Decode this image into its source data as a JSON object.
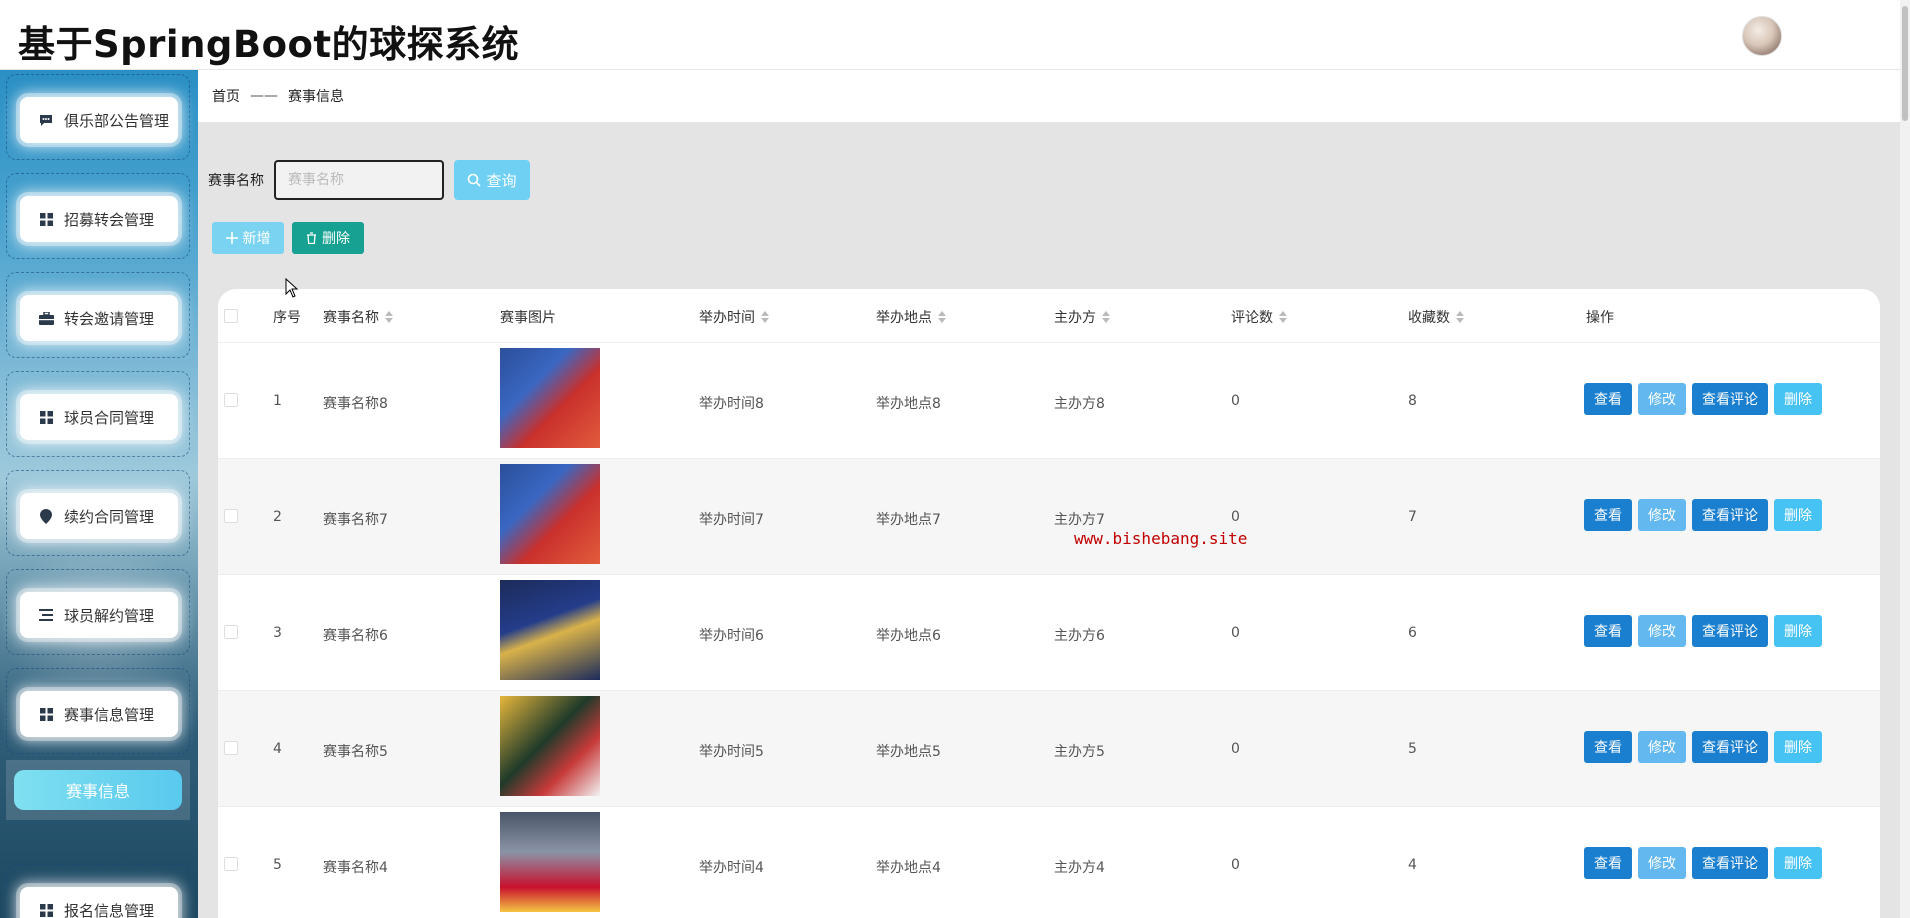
{
  "header": {
    "title": "基于SpringBoot的球探系统"
  },
  "sidebar": {
    "items": [
      {
        "label": "俱乐部公告管理",
        "icon": "chat-icon"
      },
      {
        "label": "招募转会管理",
        "icon": "grid-icon"
      },
      {
        "label": "转会邀请管理",
        "icon": "briefcase-icon"
      },
      {
        "label": "球员合同管理",
        "icon": "grid-icon"
      },
      {
        "label": "续约合同管理",
        "icon": "location-pin-icon"
      },
      {
        "label": "球员解约管理",
        "icon": "list-icon"
      },
      {
        "label": "赛事信息管理",
        "icon": "grid-icon"
      },
      {
        "label": "报名信息管理",
        "icon": "grid-icon"
      }
    ],
    "active_sub": "赛事信息"
  },
  "breadcrumb": {
    "home": "首页",
    "sep": "——",
    "current": "赛事信息"
  },
  "search": {
    "label": "赛事名称",
    "placeholder": "赛事名称",
    "value": "",
    "query_label": "查询"
  },
  "actions": {
    "add_label": "新增",
    "delete_label": "删除"
  },
  "table": {
    "headers": {
      "index": "序号",
      "name": "赛事名称",
      "image": "赛事图片",
      "time": "举办时间",
      "place": "举办地点",
      "organizer": "主办方",
      "comments": "评论数",
      "favorites": "收藏数",
      "ops": "操作"
    },
    "op_labels": {
      "view": "查看",
      "edit": "修改",
      "comments": "查看评论",
      "delete": "删除"
    },
    "rows": [
      {
        "index": "1",
        "name": "赛事名称8",
        "time": "举办时间8",
        "place": "举办地点8",
        "organizer": "主办方8",
        "comments": "0",
        "favorites": "8"
      },
      {
        "index": "2",
        "name": "赛事名称7",
        "time": "举办时间7",
        "place": "举办地点7",
        "organizer": "主办方7",
        "comments": "0",
        "favorites": "7"
      },
      {
        "index": "3",
        "name": "赛事名称6",
        "time": "举办时间6",
        "place": "举办地点6",
        "organizer": "主办方6",
        "comments": "0",
        "favorites": "6"
      },
      {
        "index": "4",
        "name": "赛事名称5",
        "time": "举办时间5",
        "place": "举办地点5",
        "organizer": "主办方5",
        "comments": "0",
        "favorites": "5"
      },
      {
        "index": "5",
        "name": "赛事名称4",
        "time": "举办时间4",
        "place": "举办地点4",
        "organizer": "主办方4",
        "comments": "0",
        "favorites": "4"
      }
    ]
  },
  "watermark": "www.bishebang.site",
  "colors": {
    "primary": "#1b7fcf",
    "teal": "#17a193",
    "light_blue": "#6fd0f3"
  }
}
